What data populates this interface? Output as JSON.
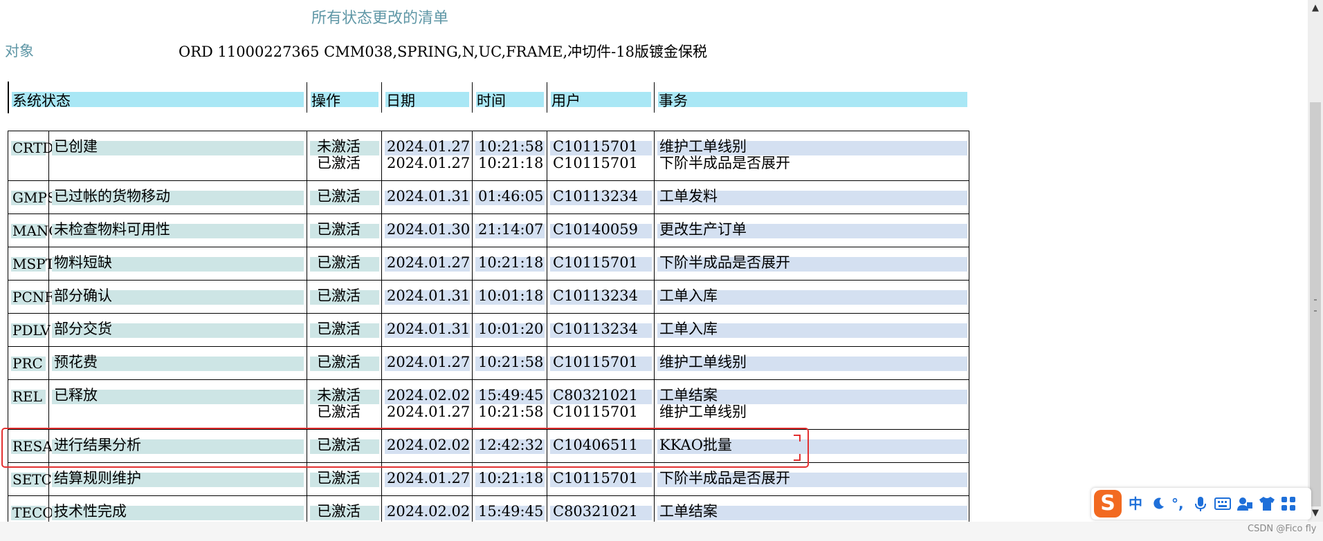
{
  "title": "所有状态更改的清单",
  "object": {
    "label": "对象",
    "value": "ORD 11000227365   CMM038,SPRING,N,UC,FRAME,冲切件-18版镀金保税"
  },
  "header": {
    "system_status": "系统状态",
    "operation": "操作",
    "date": "日期",
    "time": "时间",
    "user": "用户",
    "transaction": "事务"
  },
  "rows": [
    {
      "code": "CRTD",
      "desc": "已创建",
      "entries": [
        {
          "op": "未激活",
          "date": "2024.01.27",
          "time": "10:21:58",
          "user": "C10115701",
          "txn": "维护工单线别"
        },
        {
          "op": "已激活",
          "date": "2024.01.27",
          "time": "10:21:18",
          "user": "C10115701",
          "txn": "下阶半成品是否展开"
        }
      ]
    },
    {
      "code": "GMPS",
      "desc": "已过帐的货物移动",
      "entries": [
        {
          "op": "已激活",
          "date": "2024.01.31",
          "time": "01:46:05",
          "user": "C10113234",
          "txn": "工单发料"
        }
      ]
    },
    {
      "code": "MANC",
      "desc": "未检查物料可用性",
      "entries": [
        {
          "op": "已激活",
          "date": "2024.01.30",
          "time": "21:14:07",
          "user": "C10140059",
          "txn": "更改生产订单"
        }
      ]
    },
    {
      "code": "MSPT",
      "desc": "物料短缺",
      "entries": [
        {
          "op": "已激活",
          "date": "2024.01.27",
          "time": "10:21:18",
          "user": "C10115701",
          "txn": "下阶半成品是否展开"
        }
      ]
    },
    {
      "code": "PCNF",
      "desc": "部分确认",
      "entries": [
        {
          "op": "已激活",
          "date": "2024.01.31",
          "time": "10:01:18",
          "user": "C10113234",
          "txn": "工单入库"
        }
      ]
    },
    {
      "code": "PDLV",
      "desc": "部分交货",
      "entries": [
        {
          "op": "已激活",
          "date": "2024.01.31",
          "time": "10:01:20",
          "user": "C10113234",
          "txn": "工单入库"
        }
      ]
    },
    {
      "code": "PRC",
      "desc": "预花费",
      "entries": [
        {
          "op": "已激活",
          "date": "2024.01.27",
          "time": "10:21:58",
          "user": "C10115701",
          "txn": "维护工单线别"
        }
      ]
    },
    {
      "code": "REL",
      "desc": "已释放",
      "entries": [
        {
          "op": "未激活",
          "date": "2024.02.02",
          "time": "15:49:45",
          "user": "C80321021",
          "txn": "工单结案"
        },
        {
          "op": "已激活",
          "date": "2024.01.27",
          "time": "10:21:58",
          "user": "C10115701",
          "txn": "维护工单线别"
        }
      ]
    },
    {
      "code": "RESA",
      "desc": "进行结果分析",
      "highlighted": true,
      "entries": [
        {
          "op": "已激活",
          "date": "2024.02.02",
          "time": "12:42:32",
          "user": "C10406511",
          "txn": "KKAO批量"
        }
      ]
    },
    {
      "code": "SETC",
      "desc": "结算规则维护",
      "entries": [
        {
          "op": "已激活",
          "date": "2024.01.27",
          "time": "10:21:18",
          "user": "C10115701",
          "txn": "下阶半成品是否展开"
        }
      ]
    },
    {
      "code": "TECO",
      "desc": "技术性完成",
      "entries": [
        {
          "op": "已激活",
          "date": "2024.02.02",
          "time": "15:49:45",
          "user": "C80321021",
          "txn": "工单结案"
        }
      ]
    }
  ],
  "colors": {
    "title_text": "#5f97a6",
    "header_band": "#a9e7f5",
    "desc_band": "#cde5e5",
    "value_band": "#d4e0f1",
    "highlight": "#e23030"
  },
  "ime_toolbar": {
    "logo": "S",
    "mode_label": "中",
    "punctuation": "°,",
    "icons": [
      "moon-icon",
      "microphone-icon",
      "keyboard-icon",
      "user-card-icon",
      "shirt-icon",
      "grid-icon"
    ]
  },
  "watermark": "CSDN @Fico fly"
}
